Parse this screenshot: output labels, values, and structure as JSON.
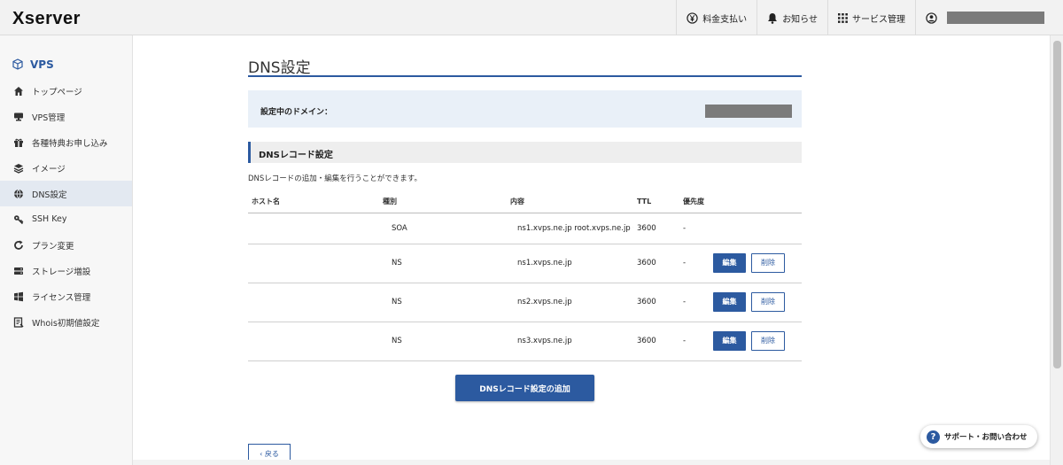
{
  "header": {
    "logo": "Xserver",
    "nav": [
      {
        "label": "料金支払い",
        "icon": "yen-icon"
      },
      {
        "label": "お知らせ",
        "icon": "bell-icon"
      },
      {
        "label": "サービス管理",
        "icon": "grid-icon"
      }
    ],
    "user_icon": "user-circle-icon"
  },
  "sidebar": {
    "title": "VPS",
    "items": [
      {
        "label": "トップページ",
        "icon": "home-icon"
      },
      {
        "label": "VPS管理",
        "icon": "server-icon"
      },
      {
        "label": "各種特典お申し込み",
        "icon": "gift-icon"
      },
      {
        "label": "イメージ",
        "icon": "layers-icon"
      },
      {
        "label": "DNS設定",
        "icon": "globe-icon",
        "active": true
      },
      {
        "label": "SSH Key",
        "icon": "key-icon"
      },
      {
        "label": "プラン変更",
        "icon": "refresh-icon"
      },
      {
        "label": "ストレージ増設",
        "icon": "storage-icon"
      },
      {
        "label": "ライセンス管理",
        "icon": "windows-icon"
      },
      {
        "label": "Whois初期値設定",
        "icon": "document-icon"
      }
    ]
  },
  "main": {
    "title": "DNS設定",
    "domain_label": "設定中のドメイン：",
    "section_title": "DNSレコード設定",
    "description": "DNSレコードの追加・編集を行うことができます。",
    "table": {
      "headers": [
        "ホスト名",
        "種別",
        "内容",
        "TTL",
        "優先度"
      ],
      "rows": [
        {
          "host": "",
          "type": "SOA",
          "content": "ns1.xvps.ne.jp root.xvps.ne.jp 0",
          "ttl": "3600",
          "priority": "-"
        },
        {
          "host": "",
          "type": "NS",
          "content": "ns1.xvps.ne.jp",
          "ttl": "3600",
          "priority": "-"
        },
        {
          "host": "",
          "type": "NS",
          "content": "ns2.xvps.ne.jp",
          "ttl": "3600",
          "priority": "-"
        },
        {
          "host": "",
          "type": "NS",
          "content": "ns3.xvps.ne.jp",
          "ttl": "3600",
          "priority": "-"
        }
      ],
      "edit_label": "編集",
      "delete_label": "削除"
    },
    "add_button": "DNSレコード設定の追加",
    "back_button": "‹ 戻る"
  },
  "support": {
    "icon_glyph": "?",
    "label": "サポート・お問い合わせ"
  },
  "colors": {
    "accent": "#2c5aa0",
    "header_bg": "#f2f2f2",
    "sidebar_bg": "#f7f7f7",
    "active_bg": "#e3e9f1",
    "domain_box_bg": "#e9f0f8",
    "mask": "#7b7b7b"
  }
}
